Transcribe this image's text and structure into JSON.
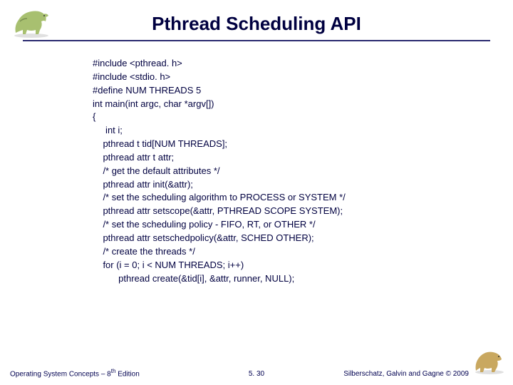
{
  "title": "Pthread Scheduling API",
  "code": {
    "l0": "#include <pthread. h>",
    "l1": "#include <stdio. h>",
    "l2": "#define NUM THREADS 5",
    "l3": "int main(int argc, char *argv[])",
    "l4": "{",
    "l5": "     int i;",
    "l6": "    pthread t tid[NUM THREADS];",
    "l7": "    pthread attr t attr;",
    "l8": "    /* get the default attributes */",
    "l9": "    pthread attr init(&attr);",
    "l10": "    /* set the scheduling algorithm to PROCESS or SYSTEM */",
    "l11": "    pthread attr setscope(&attr, PTHREAD SCOPE SYSTEM);",
    "l12": "    /* set the scheduling policy - FIFO, RT, or OTHER */",
    "l13": "    pthread attr setschedpolicy(&attr, SCHED OTHER);",
    "l14": "    /* create the threads */",
    "l15": "    for (i = 0; i < NUM THREADS; i++)",
    "l16": "          pthread create(&tid[i], &attr, runner, NULL);"
  },
  "footer": {
    "left_a": "Operating System Concepts – 8",
    "left_sup": "th",
    "left_b": " Edition",
    "center": "5. 30",
    "right": "Silberschatz, Galvin and Gagne © 2009"
  }
}
